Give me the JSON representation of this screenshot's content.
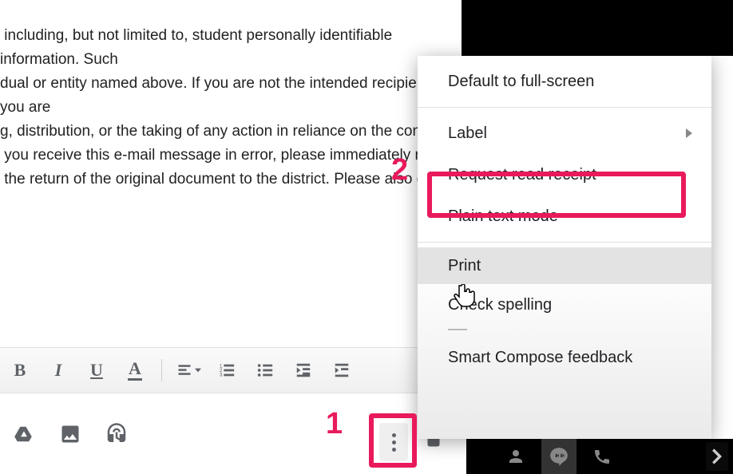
{
  "email": {
    "body_text": " including, but not limited to, student personally identifiable information. Such\ndual or entity named above. If you are not the intended recipient, you are\ng, distribution, or the taking of any action in reliance on the contents\n you receive this e-mail message in error, please immediately notify\n the return of the original document to the district. Please also delet"
  },
  "menu": {
    "default_fullscreen": "Default to full-screen",
    "label": "Label",
    "request_read_receipt": "Request read receipt",
    "plain_text_mode": "Plain text mode",
    "print": "Print",
    "check_spelling": "Check spelling",
    "smart_compose_feedback": "Smart Compose feedback"
  },
  "annotations": {
    "step1": "1",
    "step2": "2"
  },
  "toolbar": {
    "bold": "B",
    "italic": "I",
    "underline": "U",
    "text_color": "A"
  }
}
